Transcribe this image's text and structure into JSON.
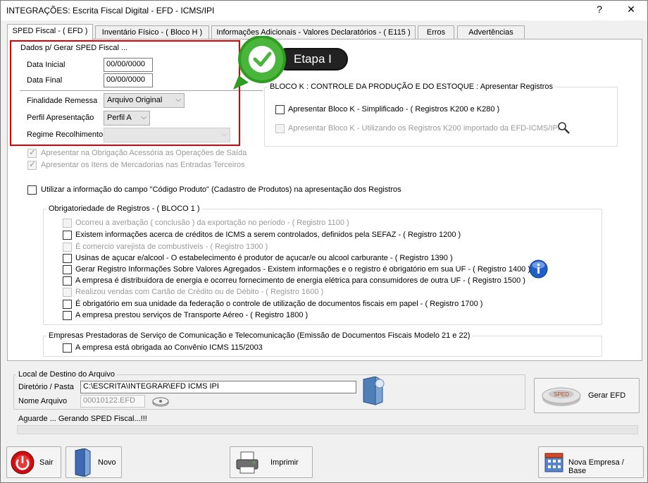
{
  "window": {
    "title": "INTEGRAÇÕES:  Escrita Fiscal Digital - EFD - ICMS/IPI",
    "help": "?",
    "close": "✕"
  },
  "tabs": [
    {
      "label": "SPED Fiscal - ( EFD )"
    },
    {
      "label": "Inventário Físico - ( Bloco H )"
    },
    {
      "label": "Informações Adicionais - Valores Declaratórios - ( E115 )"
    },
    {
      "label": "Erros"
    },
    {
      "label": "Advertências"
    }
  ],
  "dados": {
    "title": "Dados p/ Gerar SPED Fiscal ...",
    "data_inicial_label": "Data Inicial",
    "data_inicial_value": "00/00/0000",
    "data_final_label": "Data Final",
    "data_final_value": "00/00/0000",
    "finalidade_label": "Finalidade Remessa",
    "finalidade_value": "Arquivo Original",
    "perfil_label": "Perfil Apresentação",
    "perfil_value": "Perfil A",
    "regime_label": "Regime Recolhimento",
    "regime_value": ""
  },
  "etapa_badge": "Etapa I",
  "bloco_k": {
    "title": "BLOCO K : CONTROLE DA PRODUÇÃO E DO ESTOQUE : Apresentar Registros",
    "item1": "Apresentar Bloco K - Simplificado -  ( Registros K200 e K280 )",
    "item2": "Apresentar Bloco K - Utilizando os Registros K200 importado da EFD-ICMS/IPI"
  },
  "options": {
    "obrig_acessoria": "Apresentar na Obrigação Acessória as Operações de Saída",
    "itens_mercadorias": "Apresentar os Itens de Mercadorias nas Entradas Terceiros",
    "codigo_produto": "Utilizar a informação do campo \"Código Produto\" (Cadastro de Produtos) na apresentação dos Registros"
  },
  "bloco1": {
    "title": "Obrigatoriedade de Registros - ( BLOCO 1 )",
    "items": [
      {
        "text": "Ocorreu a averbação ( conclusão ) da exportação no período - ( Registro 1100 )"
      },
      {
        "text": "Existem informações acerca de créditos de ICMS a serem controlados, definidos pela SEFAZ - ( Registro 1200 )"
      },
      {
        "text": "É comercio varejista de combustíveis - ( Registro 1300 )"
      },
      {
        "text": "Usinas de açucar e/alcool - O estabelecimento é produtor de açucar/e ou alcool carburante - ( Registro 1390 )"
      },
      {
        "text": "Gerar Registro Informações Sobre Valores Agregados - Existem informações e o registro é obrigatório em sua UF - ( Registro 1400 )"
      },
      {
        "text": "A empresa é distribuidora de energia e ocorreu fornecimento de energia elétrica para consumidores de outra UF - ( Registro 1500 )"
      },
      {
        "text": "Realizou vendas com Cartão de Crédito ou de Débito - ( Registro 1600 )"
      },
      {
        "text": "É obrigatório em sua unidade da federação o controle de utilização de documentos fiscais em papel - ( Registro 1700 )"
      },
      {
        "text": "A empresa prestou serviços de Transporte Aéreo - ( Registro 1800 )"
      }
    ]
  },
  "telecom": {
    "title": "Empresas Prestadoras de Serviço de Comunicação e Telecomunicação (Emissão de Documentos Fiscais Modelo 21 e 22)",
    "item": "A empresa está obrigada ao Convênio ICMS 115/2003"
  },
  "destino": {
    "title": "Local de Destino do Arquivo",
    "dir_label": "Diretório / Pasta",
    "dir_value": "C:\\ESCRITA\\INTEGRAR\\EFD ICMS IPI",
    "file_label": "Nome Arquivo",
    "file_value": "00010122.EFD"
  },
  "gerar_label": "Gerar EFD",
  "sped_logo": "SPED",
  "status": "Aguarde ... Gerando SPED Fiscal...!!!",
  "footer": {
    "sair": "Sair",
    "novo": "Novo",
    "imprimir": "Imprimir",
    "nova_empresa": "Nova Empresa / Base"
  }
}
